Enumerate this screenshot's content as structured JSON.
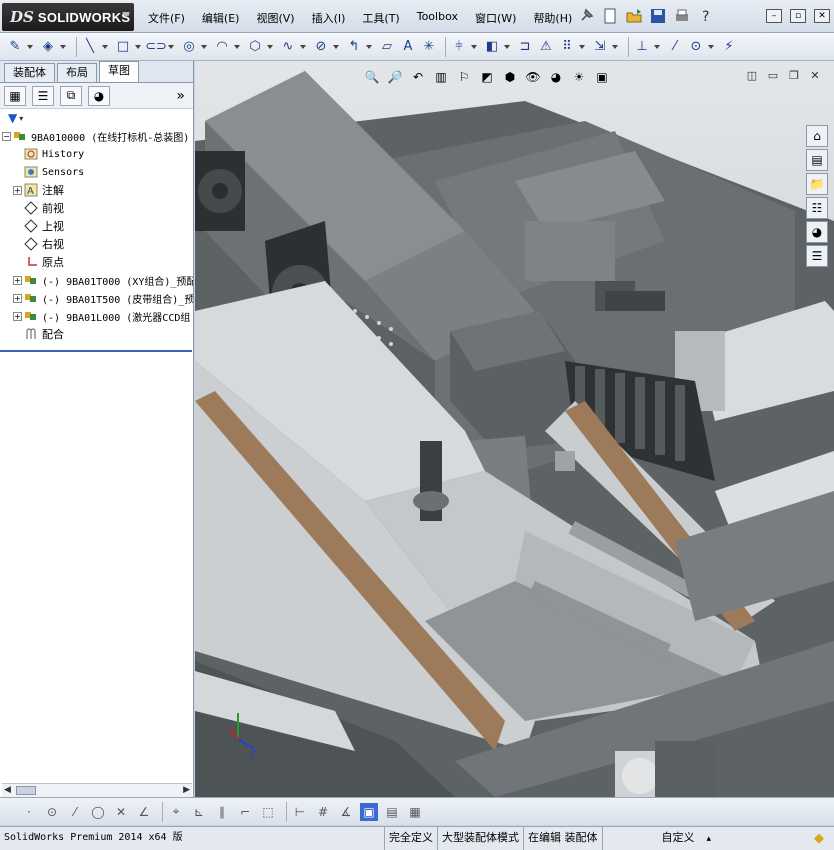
{
  "app": {
    "brand_mark": "DS",
    "brand_name": "SOLIDWORKS"
  },
  "menu": {
    "items": [
      "文件(F)",
      "编辑(E)",
      "视图(V)",
      "插入(I)",
      "工具(T)",
      "Toolbox",
      "窗口(W)",
      "帮助(H)"
    ]
  },
  "left_panel": {
    "tabs": [
      "装配体",
      "布局",
      "草图"
    ],
    "active_tab": "草图",
    "tree": [
      {
        "label": "9BA010000 (在线打标机-总装图)",
        "icon": "assembly-icon",
        "expand": "minus",
        "level": 0
      },
      {
        "label": "History",
        "icon": "history-icon",
        "expand": "",
        "level": 1
      },
      {
        "label": "Sensors",
        "icon": "sensor-icon",
        "expand": "",
        "level": 1
      },
      {
        "label": "注解",
        "icon": "annotation-icon",
        "expand": "plus",
        "level": 1
      },
      {
        "label": "前视",
        "icon": "plane-icon",
        "expand": "",
        "level": 1
      },
      {
        "label": "上视",
        "icon": "plane-icon",
        "expand": "",
        "level": 1
      },
      {
        "label": "右视",
        "icon": "plane-icon",
        "expand": "",
        "level": 1
      },
      {
        "label": "原点",
        "icon": "origin-icon",
        "expand": "",
        "level": 1
      },
      {
        "label": "(-) 9BA01T000 (XY组合)_预配",
        "icon": "subassembly-icon",
        "expand": "plus",
        "level": 1
      },
      {
        "label": "(-) 9BA01T500 (皮带组合)_预",
        "icon": "subassembly-icon",
        "expand": "plus",
        "level": 1
      },
      {
        "label": "(-) 9BA01L000 (激光器CCD组",
        "icon": "subassembly-icon",
        "expand": "plus",
        "level": 1
      },
      {
        "label": "配合",
        "icon": "mates-icon",
        "expand": "",
        "level": 1
      }
    ]
  },
  "status": {
    "version": "SolidWorks Premium 2014 x64 版",
    "state": "完全定义",
    "mode": "大型装配体模式",
    "editing": "在编辑 装配体",
    "units": "自定义"
  },
  "colors": {
    "frame": "#c9d3e0",
    "model_gray": "#5f6466",
    "plate_light": "#d8dcdf",
    "accent_blue": "#1e53c4"
  }
}
